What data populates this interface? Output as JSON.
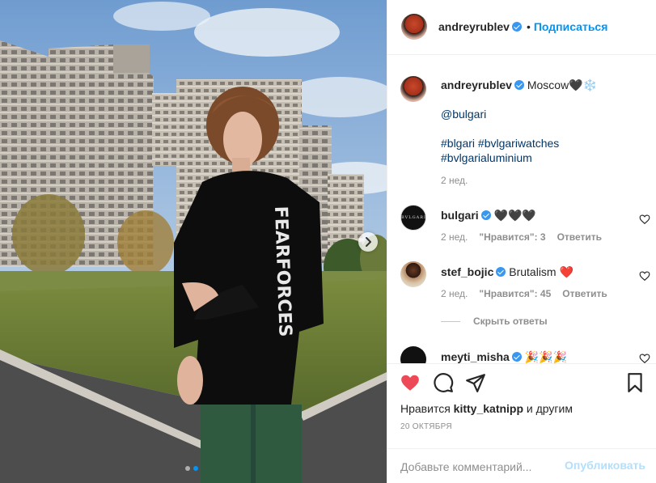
{
  "post": {
    "author": "andreyrublev",
    "follow_label": "Подписаться",
    "separator": "•",
    "caption": {
      "location_text": "Moscow🖤❄️",
      "mention": "@bulgari",
      "hashtags_line1": "#blgari #bvlgariwatches",
      "hashtags_line2": "#bvlgarialuminium",
      "time": "2 нед."
    }
  },
  "comments": [
    {
      "user": "bulgari",
      "avatar_text": "BVLGARI",
      "text": "🖤🖤🖤",
      "time": "2 нед.",
      "likes": "\"Нравится\": 3",
      "reply": "Ответить"
    },
    {
      "user": "stef_bojic",
      "text": "Brutalism ❤️",
      "time": "2 нед.",
      "likes": "\"Нравится\": 45",
      "reply": "Ответить"
    },
    {
      "user": "meyti_misha",
      "text": "🎉🎉🎉"
    }
  ],
  "hide_replies": "Скрыть ответы",
  "actions": {
    "liked_by_prefix": "Нравится",
    "liked_by_user": "kitty_katnipp",
    "liked_by_suffix": "и другим",
    "date": "20 ОКТЯБРЯ"
  },
  "comment_box": {
    "placeholder": "Добавьте комментарий...",
    "publish_label": "Опубликовать"
  },
  "photo": {
    "sweatshirt_text": "FEARFORCES",
    "carousel_dots": 2,
    "active_dot": 2
  },
  "colors": {
    "accent_blue": "#0095f6",
    "like_red": "#ed4956",
    "publish_disabled": "#b2dffc"
  }
}
